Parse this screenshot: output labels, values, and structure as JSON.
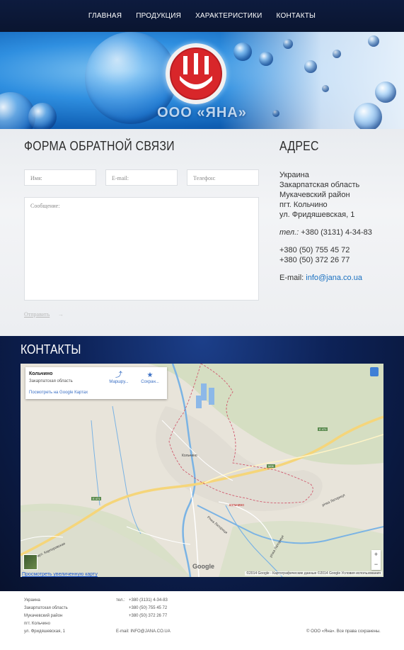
{
  "nav": {
    "items": [
      "ГЛАВНАЯ",
      "ПРОДУКЦИЯ",
      "ХАРАКТЕРИСТИКИ",
      "КОНТАКТЫ"
    ]
  },
  "banner": {
    "company_name": "ООО «ЯНА»",
    "logo": "red-shield-logo"
  },
  "form": {
    "title": "ФОРМА ОБРАТНОЙ СВЯЗИ",
    "name_placeholder": "Имя:",
    "email_placeholder": "E-mail:",
    "phone_placeholder": "Телефон:",
    "message_placeholder": "Сообщение:",
    "send_label": "Отправить",
    "send_arrow": "→"
  },
  "address": {
    "title": "АДРЕС",
    "lines": [
      "Украина",
      "Закарпатская область",
      "Мукачевский район",
      "пгт. Кольчино",
      "ул. Фридяшевская, 1"
    ],
    "tel_label": "тел.:",
    "tel_value": " +380 (3131) 4-34-83",
    "mobile1": "+380 (50) 755 45 72",
    "mobile2": "+380 (50) 372 26 77",
    "email_label": "E-mail: ",
    "email_value": "info@jana.co.ua"
  },
  "contacts": {
    "title": "КОНТАКТЫ",
    "map": {
      "place_name": "Кольчино",
      "place_region": "Закарпатская область",
      "view_on_google": "Посмотреть на Google Картах",
      "route_label": "Маршру...",
      "save_label": "Сохран...",
      "route_icon": "directions-icon",
      "save_icon": "star-icon",
      "zoom_in": "+",
      "zoom_out": "−",
      "view_larger": "Просмотреть увеличенную карту",
      "google_logo": "Google",
      "attribution": "©2014 Google - Картографические данные ©2014 Google     Условия использования",
      "labels": {
        "kolchino_center": "Кольчино",
        "kolchino_south": "кольчино",
        "river_latoritsa1": "річка Латориця",
        "river_latoritsa2": "Річка Латориця",
        "river_latoritsa3": "річка Латориця",
        "street": "вул. Кирпоровская"
      },
      "shields": [
        "E 471",
        "E 471",
        "M06"
      ]
    }
  },
  "footer": {
    "addr_lines": [
      "Украина",
      "Закарпатская область",
      "Мукачевский район",
      "пгт. Кольчино",
      "ул. Фридяшевская, 1"
    ],
    "tel_label": "тел.:",
    "phones": [
      "+380 (3131) 4-34-83",
      "+380 (50) 755 45 72",
      "+380 (50) 372 26 77"
    ],
    "email": "E-mail: INFO@JANA.CO.UA",
    "copyright": "© ООО «Яна». Все права сохранены."
  }
}
